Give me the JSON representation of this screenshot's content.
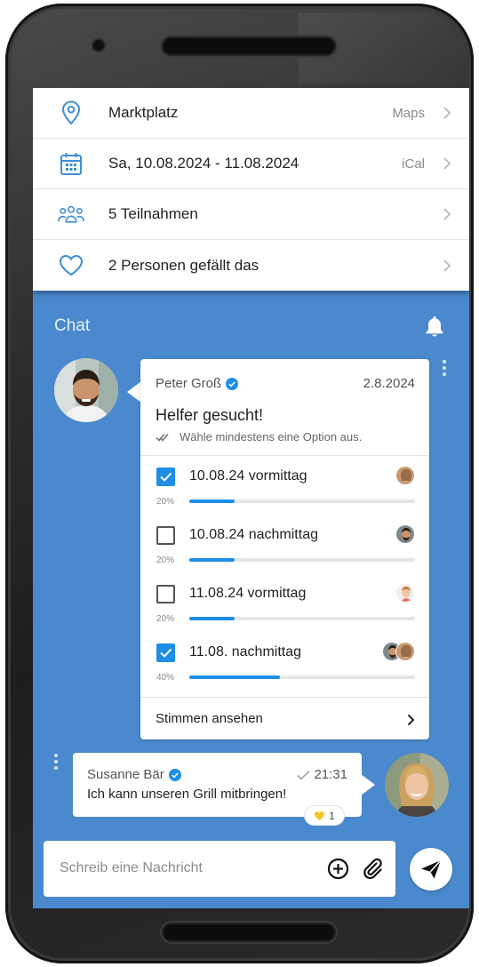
{
  "event_info": {
    "items": [
      {
        "icon": "location-pin-icon",
        "label": "Marktplatz",
        "action": "Maps"
      },
      {
        "icon": "calendar-icon",
        "label": "Sa, 10.08.2024 - 11.08.2024",
        "action": "iCal"
      },
      {
        "icon": "people-icon",
        "label": "5 Teilnahmen",
        "action": ""
      },
      {
        "icon": "heart-icon",
        "label": "2 Personen gefällt das",
        "action": ""
      }
    ]
  },
  "chat": {
    "title": "Chat",
    "poll": {
      "author": "Peter Groß",
      "date": "2.8.2024",
      "question": "Helfer gesucht!",
      "hint": "Wähle mindestens eine Option aus.",
      "options": [
        {
          "label": "10.08.24 vormittag",
          "checked": true,
          "percent": "20%",
          "share": 0.2
        },
        {
          "label": "10.08.24 nachmittag",
          "checked": false,
          "percent": "20%",
          "share": 0.2
        },
        {
          "label": "11.08.24 vormittag",
          "checked": false,
          "percent": "20%",
          "share": 0.2
        },
        {
          "label": "11.08. nachmittag",
          "checked": true,
          "percent": "40%",
          "share": 0.4
        }
      ],
      "see_votes_label": "Stimmen ansehen"
    },
    "message": {
      "author": "Susanne Bär",
      "time": "21:31",
      "text": "Ich kann unseren Grill mitbringen!",
      "reaction_count": "1"
    },
    "composer": {
      "placeholder": "Schreib eine Nachricht"
    }
  },
  "colors": {
    "chat_background": "#4a89cd",
    "accent": "#1e8ee6",
    "icon_blue": "#3d8fd8"
  }
}
